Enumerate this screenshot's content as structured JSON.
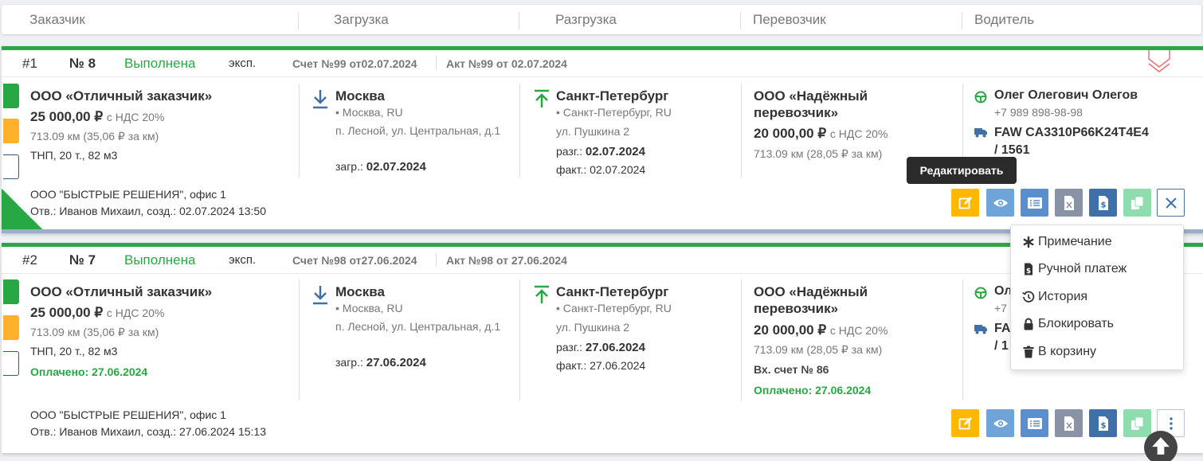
{
  "header": {
    "columns": [
      "Заказчик",
      "Загрузка",
      "Разгрузка",
      "Перевозчик",
      "Водитель"
    ]
  },
  "orders": [
    {
      "index": "#1",
      "number": "№ 8",
      "status": "Выполнена",
      "type": "эксп.",
      "invoice": "Счет №99 от02.07.2024",
      "act": "Акт №99 от 02.07.2024",
      "customer": {
        "name": "ООО «Отличный заказчик»",
        "price": "25 000,00 ₽",
        "vat": "с НДС 20%",
        "distance": "713.09 км (35,06 ₽ за км)",
        "cargo": "ТНП, 20 т., 82 м3"
      },
      "loading": {
        "city": "Москва",
        "region": "• Москва, RU",
        "address": "п. Лесной, ул. Центральная, д.1",
        "date_label": "загр.:",
        "date": "02.07.2024"
      },
      "unloading": {
        "city": "Санкт-Петербург",
        "region": "• Санкт-Петербург, RU",
        "address": "ул. Пушкина 2",
        "date_label": "разг.:",
        "date": "02.07.2024",
        "fact_label": "факт.:",
        "fact": "02.07.2024"
      },
      "carrier": {
        "name_line1": "ООО «Надёжный",
        "name_line2": "перевозчик»",
        "price": "20 000,00 ₽",
        "vat": "с НДС 20%",
        "distance": "713.09 км (28,05 ₽ за км)"
      },
      "driver": {
        "name": "Олег Олегович Олегов",
        "phone": "+7 989 898-98-98",
        "truck_line1": "FAW CA3310P66K24T4E4",
        "truck_line2": "/ 1561"
      },
      "office": "ООО \"БЫСТРЫЕ РЕШЕНИЯ\", офис 1",
      "responsible": "Отв.: Иванов Михаил, созд.: 02.07.2024 13:50"
    },
    {
      "index": "#2",
      "number": "№ 7",
      "status": "Выполнена",
      "type": "эксп.",
      "invoice": "Счет №98 от27.06.2024",
      "act": "Акт №98 от 27.06.2024",
      "customer": {
        "name": "ООО «Отличный заказчик»",
        "price": "25 000,00 ₽",
        "vat": "с НДС 20%",
        "distance": "713.09 км (35,06 ₽ за км)",
        "cargo": "ТНП, 20 т., 82 м3",
        "paid": "Оплачено: 27.06.2024"
      },
      "loading": {
        "city": "Москва",
        "region": "• Москва, RU",
        "address": "п. Лесной, ул. Центральная, д.1",
        "date_label": "загр.:",
        "date": "27.06.2024"
      },
      "unloading": {
        "city": "Санкт-Петербург",
        "region": "• Санкт-Петербург, RU",
        "address": "ул. Пушкина 2",
        "date_label": "разг.:",
        "date": "27.06.2024",
        "fact_label": "факт.:",
        "fact": "27.06.2024"
      },
      "carrier": {
        "name_line1": "ООО «Надёжный",
        "name_line2": "перевозчик»",
        "price": "20 000,00 ₽",
        "vat": "с НДС 20%",
        "distance": "713.09 км (28,05 ₽ за км)",
        "incoming_invoice": "Вх. счет № 86",
        "paid": "Оплачено: 27.06.2024"
      },
      "driver": {
        "name_partial": "Ол",
        "phone_partial": "+7",
        "truck_partial_1": "FA",
        "truck_partial_2": "/ 1"
      },
      "office": "ООО \"БЫСТРЫЕ РЕШЕНИЯ\", офис 1",
      "responsible": "Отв.: Иванов Михаил, созд.: 27.06.2024 15:13"
    }
  ],
  "tooltip": "Редактировать",
  "menu": {
    "items": [
      {
        "label": "Примечание",
        "icon": "asterisk-icon"
      },
      {
        "label": "Ручной платеж",
        "icon": "invoice-dollar-icon"
      },
      {
        "label": "История",
        "icon": "history-icon"
      },
      {
        "label": "Блокировать",
        "icon": "lock-icon"
      },
      {
        "label": "В корзину",
        "icon": "trash-icon"
      }
    ]
  },
  "colors": {
    "accent_green": "#28a745",
    "edit_yellow": "#ffb800",
    "brand_blue": "#3f71a8"
  }
}
